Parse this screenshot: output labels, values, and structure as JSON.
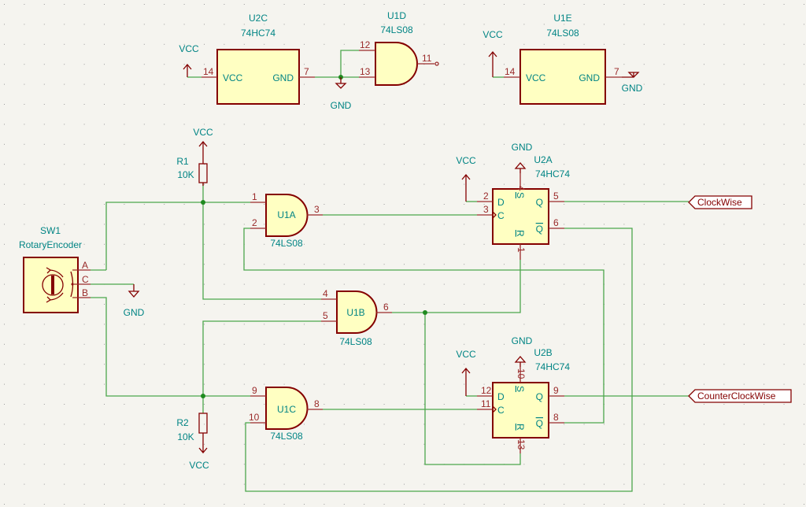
{
  "colors": {
    "background": "#f5f4ef",
    "wire": "#4ca64c",
    "symbol_outline": "#840000",
    "symbol_fill": "#ffffc2",
    "text": "#008484",
    "pin_number": "#9a2a2a"
  },
  "power": {
    "vcc": "VCC",
    "gnd": "GND"
  },
  "u2c": {
    "ref": "U2C",
    "value": "74HC74",
    "pin_vcc": "14",
    "pin_gnd": "7",
    "name_vcc": "VCC",
    "name_gnd": "GND"
  },
  "u1d": {
    "ref": "U1D",
    "value": "74LS08",
    "pin_a": "12",
    "pin_b": "13",
    "pin_y": "11"
  },
  "u1e": {
    "ref": "U1E",
    "value": "74LS08",
    "pin_vcc": "14",
    "pin_gnd": "7",
    "name_vcc": "VCC",
    "name_gnd": "GND"
  },
  "r1": {
    "ref": "R1",
    "value": "10K"
  },
  "r2": {
    "ref": "R2",
    "value": "10K"
  },
  "sw1": {
    "ref": "SW1",
    "value": "RotaryEncoder",
    "pin_a": "A",
    "pin_c": "C",
    "pin_b": "B"
  },
  "u1a": {
    "ref": "U1A",
    "value": "74LS08",
    "pin_a": "1",
    "pin_b": "2",
    "pin_y": "3"
  },
  "u1b": {
    "ref": "U1B",
    "value": "74LS08",
    "pin_a": "4",
    "pin_b": "5",
    "pin_y": "6"
  },
  "u1c": {
    "ref": "U1C",
    "value": "74LS08",
    "pin_a": "9",
    "pin_b": "10",
    "pin_y": "8"
  },
  "u2a": {
    "ref": "U2A",
    "value": "74HC74",
    "pin_d": "2",
    "pin_c": "3",
    "pin_s": "4",
    "pin_r": "1",
    "pin_q": "5",
    "pin_qn": "6",
    "name_d": "D",
    "name_c": "C",
    "name_s": "S",
    "name_r": "R",
    "name_q": "Q",
    "name_qn": "Q"
  },
  "u2b": {
    "ref": "U2B",
    "value": "74HC74",
    "pin_d": "12",
    "pin_c": "11",
    "pin_s": "10",
    "pin_r": "13",
    "pin_q": "9",
    "pin_qn": "8",
    "name_d": "D",
    "name_c": "C",
    "name_s": "S",
    "name_r": "R",
    "name_q": "Q",
    "name_qn": "Q"
  },
  "net_labels": {
    "cw": "ClockWise",
    "ccw": "CounterClockWise"
  }
}
